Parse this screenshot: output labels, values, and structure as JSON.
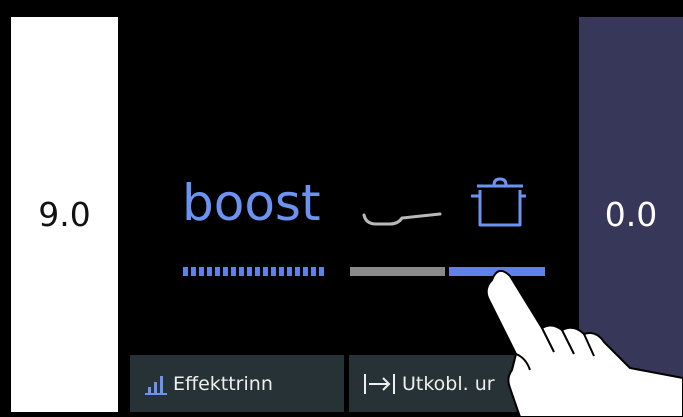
{
  "left_value": "9.0",
  "right_value": "0.0",
  "mode_label": "boost",
  "buttons": {
    "effect_level": "Effekttrinn",
    "timer": "Utkobl. ur"
  },
  "icons": {
    "pan": "frying-pan-icon",
    "pot": "cooking-pot-icon",
    "effect": "bar-chart-icon",
    "timer": "arrow-to-bar-icon",
    "hand": "pointing-hand-icon"
  },
  "colors": {
    "accent": "#6d93f2",
    "right_panel": "#37375a",
    "button_bg": "#263236"
  }
}
